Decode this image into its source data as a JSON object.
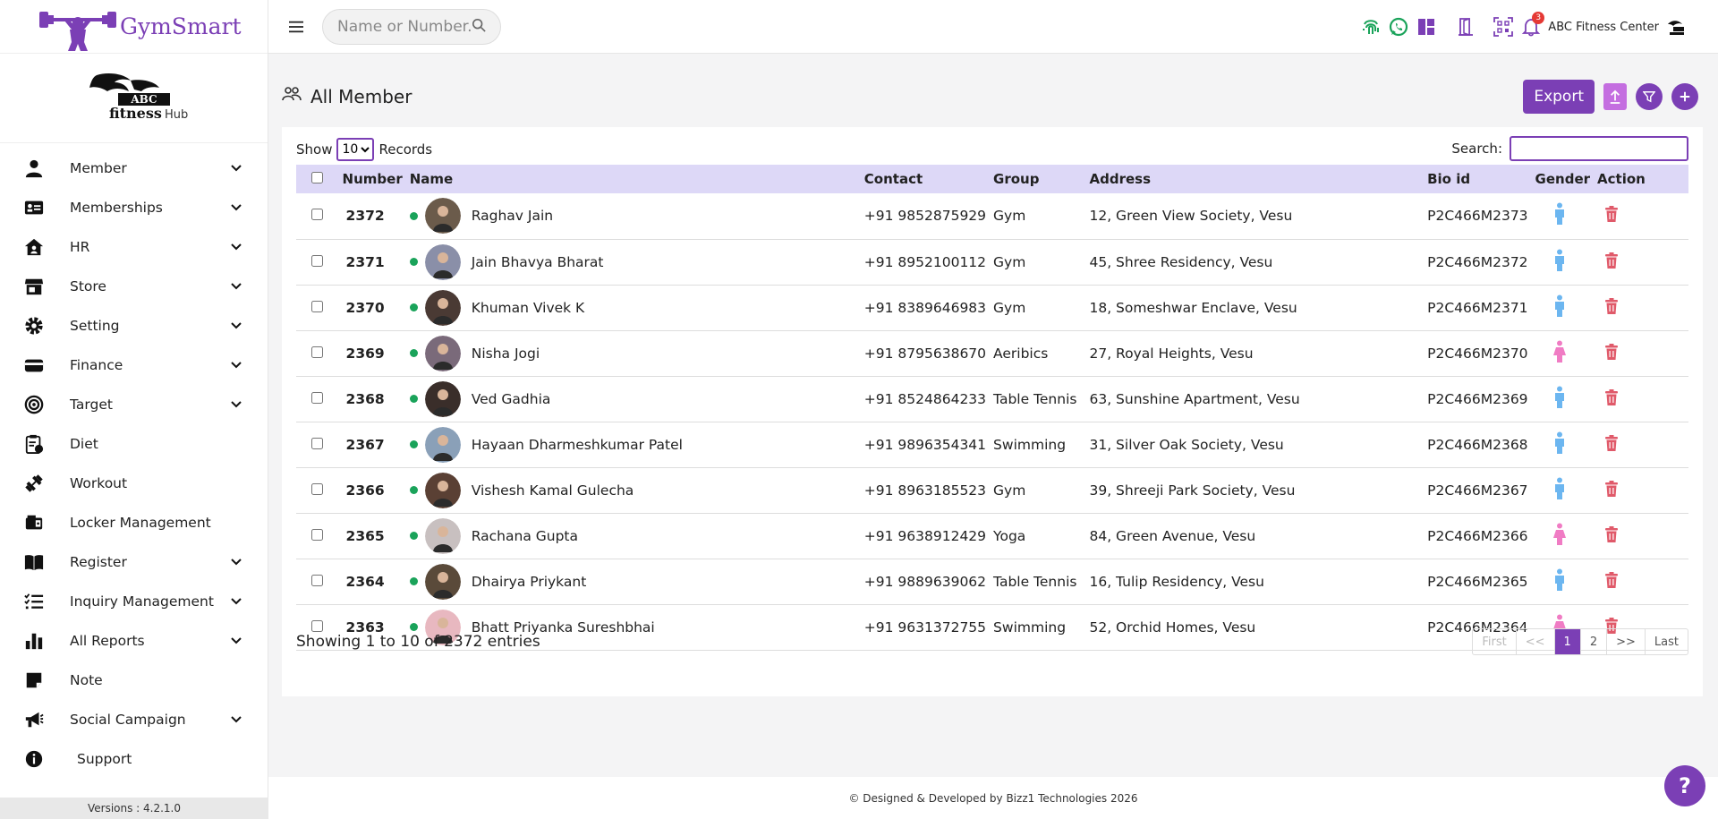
{
  "brand": {
    "name": "GymSmart"
  },
  "gym": {
    "logo_line1": "ABC",
    "logo_line2": "fitness",
    "logo_line3": "Hub"
  },
  "sidebar": {
    "items": [
      {
        "label": "Member",
        "icon": "person-icon",
        "dropdown": true
      },
      {
        "label": "Memberships",
        "icon": "id-card-icon",
        "dropdown": true
      },
      {
        "label": "HR",
        "icon": "house-user-icon",
        "dropdown": true
      },
      {
        "label": "Store",
        "icon": "store-icon",
        "dropdown": true
      },
      {
        "label": "Setting",
        "icon": "gear-icon",
        "dropdown": true
      },
      {
        "label": "Finance",
        "icon": "credit-card-icon",
        "dropdown": true
      },
      {
        "label": "Target",
        "icon": "target-icon",
        "dropdown": true
      },
      {
        "label": "Diet",
        "icon": "diet-clipboard-icon",
        "dropdown": false
      },
      {
        "label": "Workout",
        "icon": "dumbbell-icon",
        "dropdown": false
      },
      {
        "label": "Locker Management",
        "icon": "locker-icon",
        "dropdown": false
      },
      {
        "label": "Register",
        "icon": "book-icon",
        "dropdown": true
      },
      {
        "label": "Inquiry Management",
        "icon": "checklist-icon",
        "dropdown": true
      },
      {
        "label": "All Reports",
        "icon": "bar-chart-icon",
        "dropdown": true
      },
      {
        "label": "Note",
        "icon": "note-icon",
        "dropdown": false
      },
      {
        "label": "Social Campaign",
        "icon": "megaphone-icon",
        "dropdown": true
      },
      {
        "label": "Support",
        "icon": "info-icon",
        "dropdown": false
      }
    ],
    "version": "Versions : 4.2.1.0"
  },
  "header": {
    "search_placeholder": "Name or Number...",
    "notification_count": "3",
    "center_name": "ABC Fitness Center"
  },
  "page": {
    "title": "All Member",
    "export_label": "Export"
  },
  "table": {
    "show_label": "Show",
    "records_label": "Records",
    "page_size": "10",
    "search_label": "Search:",
    "columns": [
      "Number",
      "Name",
      "Contact",
      "Group",
      "Address",
      "Bio id",
      "Gender",
      "Action"
    ],
    "rows": [
      {
        "number": "2372",
        "name": "Raghav Jain",
        "contact": "+91 9852875929",
        "group": "Gym",
        "address": "12, Green View Society, Vesu",
        "bio": "P2C466M2373",
        "gender": "male"
      },
      {
        "number": "2371",
        "name": "Jain Bhavya Bharat",
        "contact": "+91 8952100112",
        "group": "Gym",
        "address": "45, Shree Residency, Vesu",
        "bio": "P2C466M2372",
        "gender": "male"
      },
      {
        "number": "2370",
        "name": "Khuman Vivek K",
        "contact": "+91 8389646983",
        "group": "Gym",
        "address": "18, Someshwar Enclave, Vesu",
        "bio": "P2C466M2371",
        "gender": "male"
      },
      {
        "number": "2369",
        "name": "Nisha Jogi",
        "contact": "+91 8795638670",
        "group": "Aeribics",
        "address": "27, Royal Heights, Vesu",
        "bio": "P2C466M2370",
        "gender": "female"
      },
      {
        "number": "2368",
        "name": "Ved Gadhia",
        "contact": "+91 8524864233",
        "group": "Table Tennis",
        "address": "63, Sunshine Apartment, Vesu",
        "bio": "P2C466M2369",
        "gender": "male"
      },
      {
        "number": "2367",
        "name": "Hayaan Dharmeshkumar Patel",
        "contact": "+91 9896354341",
        "group": "Swimming",
        "address": "31, Silver Oak Society, Vesu",
        "bio": "P2C466M2368",
        "gender": "male"
      },
      {
        "number": "2366",
        "name": "Vishesh Kamal Gulecha",
        "contact": "+91 8963185523",
        "group": "Gym",
        "address": "39, Shreeji Park Society, Vesu",
        "bio": "P2C466M2367",
        "gender": "male"
      },
      {
        "number": "2365",
        "name": "Rachana Gupta",
        "contact": "+91 9638912429",
        "group": "Yoga",
        "address": "84, Green Avenue, Vesu",
        "bio": "P2C466M2366",
        "gender": "female"
      },
      {
        "number": "2364",
        "name": "Dhairya Priykant",
        "contact": "+91 9889639062",
        "group": "Table Tennis",
        "address": "16, Tulip Residency, Vesu",
        "bio": "P2C466M2365",
        "gender": "male"
      },
      {
        "number": "2363",
        "name": "Bhatt Priyanka Sureshbhai",
        "contact": "+91 9631372755",
        "group": "Swimming",
        "address": "52, Orchid Homes, Vesu",
        "bio": "P2C466M2364",
        "gender": "female"
      }
    ],
    "showing_text": "Showing 1 to 10 of 2372 entries",
    "pager": [
      "First",
      "<<",
      "1",
      "2",
      ">>",
      "Last"
    ]
  },
  "footer": {
    "copyright": "© Designed & Developed by Bizz1 Technologies 2026"
  },
  "help": {
    "label": "?"
  },
  "colors": {
    "accent": "#7b3fb5",
    "header_row": "#ddd8f7",
    "active_dot": "#1aa35a",
    "male": "#6cb6f0",
    "female": "#f07cc4",
    "delete": "#e05a6a"
  }
}
